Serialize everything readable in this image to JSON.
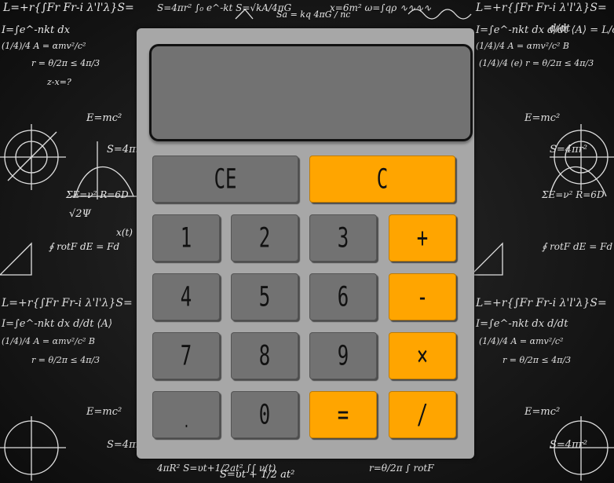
{
  "display": {
    "value": ""
  },
  "keys": {
    "ce": "CE",
    "c": "C",
    "one": "1",
    "two": "2",
    "three": "3",
    "plus": "+",
    "four": "4",
    "five": "5",
    "six": "6",
    "minus": "-",
    "seven": "7",
    "eight": "8",
    "nine": "9",
    "times": "×",
    "dot": ".",
    "zero": "0",
    "equals": "=",
    "divide": "/"
  },
  "background_formulas": [
    "L=+r{∫Fr Fr-i λ'l'λ}S=",
    "I=∫e^-nkt dx",
    "(1/4)/4 A = αmv²/c²",
    "r = θ/2π ≤ 4π/3",
    "E=mc²",
    "S=4πr²",
    "ΣE=ν² R=6D",
    "√2Ψ",
    "∮ rotF dE = Fd",
    "S=υt + 1/2 at²",
    "Sa = kq 4πG / nc",
    "d/dt",
    "z-x=?",
    "x(t)"
  ],
  "colors": {
    "body": "#a7a7a7",
    "display": "#727272",
    "number_key": "#727272",
    "operator_key": "#ffa500"
  }
}
